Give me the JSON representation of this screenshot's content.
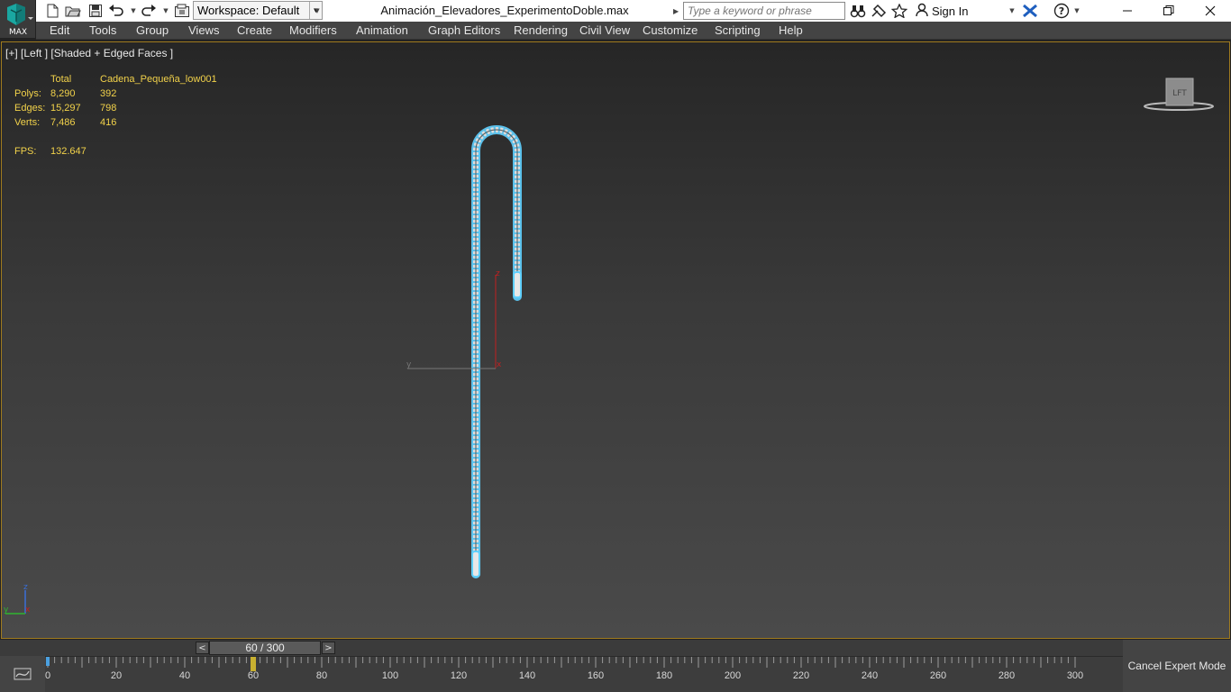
{
  "app": {
    "logo_text": "MAX",
    "window_title": "Animación_Elevadores_ExperimentoDoble.max"
  },
  "quick_access": {
    "workspace_label": "Workspace: Default"
  },
  "search": {
    "placeholder": "Type a keyword or phrase"
  },
  "account": {
    "sign_in_label": "Sign In"
  },
  "menu": {
    "items": [
      "Edit",
      "Tools",
      "Group",
      "Views",
      "Create",
      "Modifiers",
      "Animation",
      "Graph Editors",
      "Rendering",
      "Civil View",
      "Customize",
      "Scripting",
      "Help"
    ]
  },
  "viewport": {
    "label": "[+] [Left ] [Shaded + Edged Faces ]",
    "stats": {
      "header_total": "Total",
      "header_object": "Cadena_Pequeña_low001",
      "rows": [
        {
          "label": "Polys:",
          "total": "8,290",
          "object": "392"
        },
        {
          "label": "Edges:",
          "total": "15,297",
          "object": "798"
        },
        {
          "label": "Verts:",
          "total": "7,486",
          "object": "416"
        }
      ],
      "fps_label": "FPS:",
      "fps_value": "132.647"
    },
    "viewcube_label": "LFT",
    "gizmo": {
      "z_label": "z",
      "x_label": "x",
      "y_label": "y"
    },
    "axis_tripod": {
      "z_label": "z",
      "y_label": "y",
      "x_label": "x"
    },
    "colors": {
      "selection": "#5fd0ff",
      "axis_z": "#c02020",
      "axis_x": "#c02020",
      "axis_y": "#777777",
      "border": "#a07b1e"
    }
  },
  "time_slider": {
    "position_label": "60 / 300",
    "prev_label": "<",
    "next_label": ">",
    "current_frame": 60,
    "total_frames": 300
  },
  "trackbar": {
    "tick_labels": [
      "0",
      "20",
      "40",
      "60",
      "80",
      "100",
      "120",
      "140",
      "160",
      "180",
      "200",
      "220",
      "240",
      "260",
      "280",
      "300"
    ]
  },
  "expert_mode": {
    "cancel_label": "Cancel Expert Mode"
  }
}
